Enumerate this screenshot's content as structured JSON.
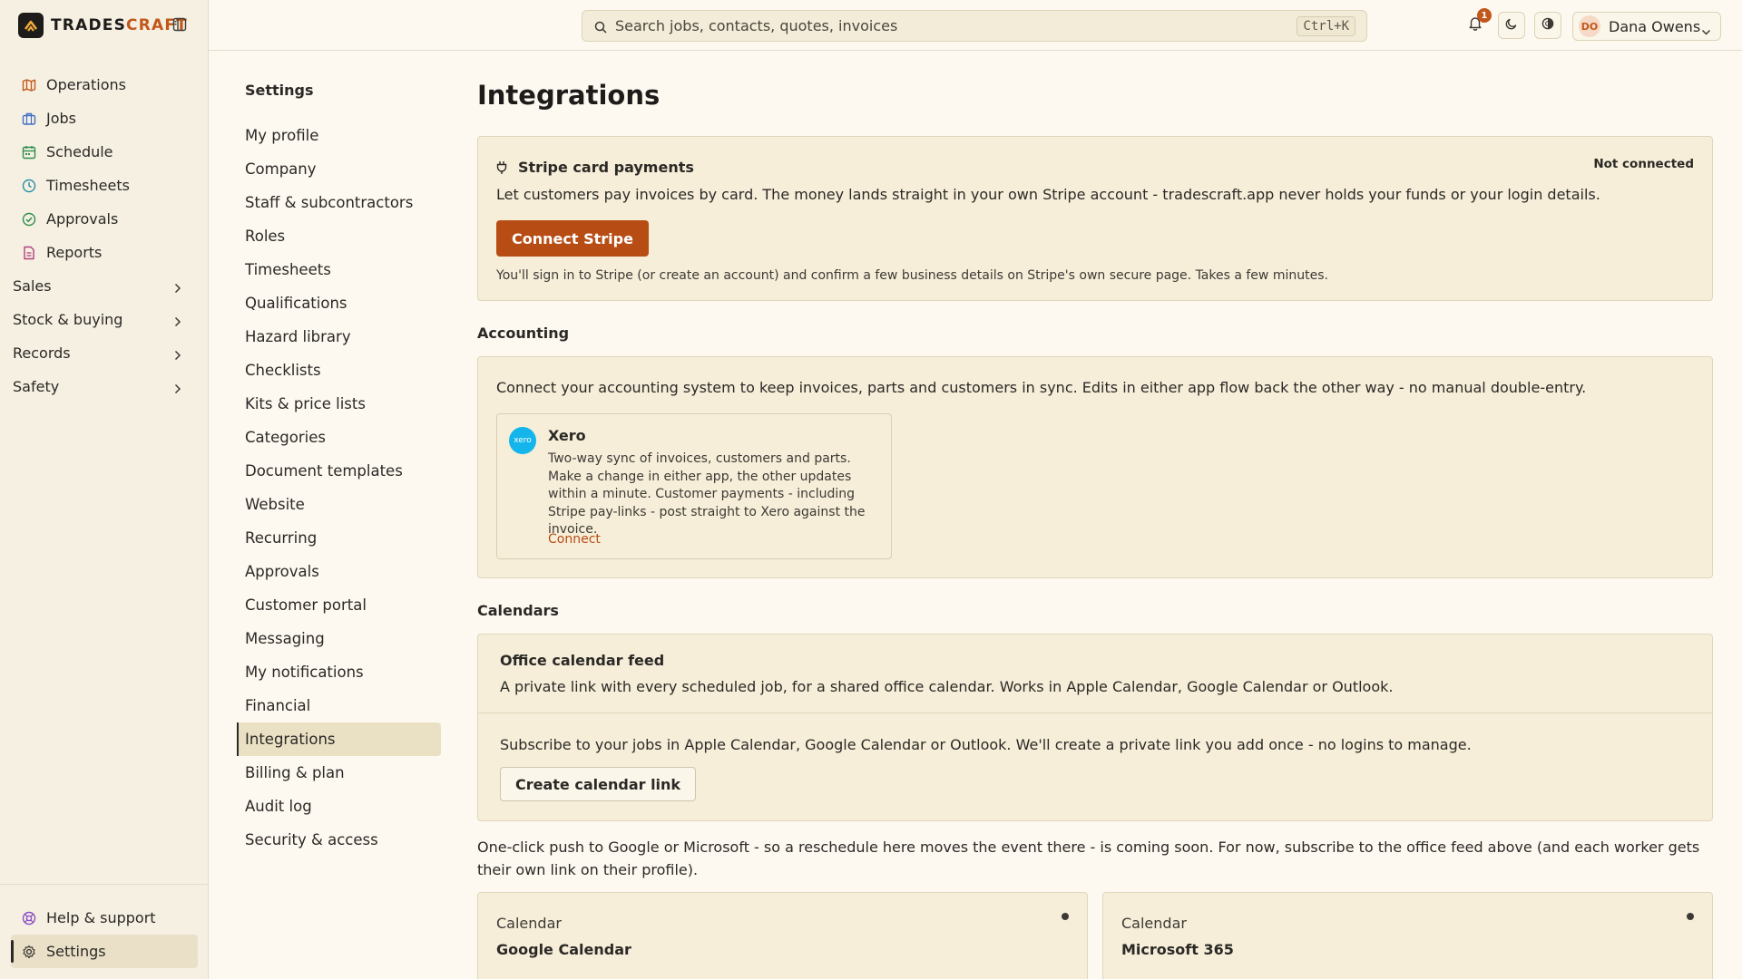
{
  "brand": {
    "name_part1": "TRADES",
    "name_part2": "CRAFT"
  },
  "sidebar": {
    "items": [
      {
        "label": "Operations",
        "icon": "map-icon",
        "color": "#c2571b"
      },
      {
        "label": "Jobs",
        "icon": "briefcase-icon",
        "color": "#3f6ec4"
      },
      {
        "label": "Schedule",
        "icon": "calendar-icon",
        "color": "#2f8f4e"
      },
      {
        "label": "Timesheets",
        "icon": "clock-icon",
        "color": "#2b8fa3"
      },
      {
        "label": "Approvals",
        "icon": "check-circle-icon",
        "color": "#2f8f4e"
      },
      {
        "label": "Reports",
        "icon": "report-icon",
        "color": "#b1407f"
      }
    ],
    "groups": [
      {
        "label": "Sales"
      },
      {
        "label": "Stock & buying"
      },
      {
        "label": "Records"
      },
      {
        "label": "Safety"
      }
    ],
    "bottom": [
      {
        "label": "Help & support",
        "icon": "help-icon",
        "color": "#8a4fc2"
      },
      {
        "label": "Settings",
        "icon": "gear-icon",
        "color": "#3d3a35"
      }
    ]
  },
  "topbar": {
    "search_placeholder": "Search jobs, contacts, quotes, invoices",
    "shortcut": "Ctrl+K",
    "notification_count": "1",
    "user_initials": "DO",
    "user_name": "Dana Owens"
  },
  "settings_nav": {
    "title": "Settings",
    "items": [
      "My profile",
      "Company",
      "Staff & subcontractors",
      "Roles",
      "Timesheets",
      "Qualifications",
      "Hazard library",
      "Checklists",
      "Kits & price lists",
      "Categories",
      "Document templates",
      "Website",
      "Recurring",
      "Approvals",
      "Customer portal",
      "Messaging",
      "My notifications",
      "Financial",
      "Integrations",
      "Billing & plan",
      "Audit log",
      "Security & access"
    ],
    "active_index": 18
  },
  "main": {
    "title": "Integrations",
    "stripe": {
      "title": "Stripe card payments",
      "status": "Not connected",
      "description": "Let customers pay invoices by card. The money lands straight in your own Stripe account - tradescraft.app never holds your funds or your login details.",
      "button": "Connect Stripe",
      "note": "You'll sign in to Stripe (or create an account) and confirm a few business details on Stripe's own secure page. Takes a few minutes."
    },
    "accounting": {
      "heading": "Accounting",
      "description": "Connect your accounting system to keep invoices, parts and customers in sync. Edits in either app flow back the other way - no manual double-entry.",
      "xero": {
        "logo_text": "xero",
        "name": "Xero",
        "description": "Two-way sync of invoices, customers and parts. Make a change in either app, the other updates within a minute. Customer payments - including Stripe pay-links - post straight to Xero against the invoice.",
        "link": "Connect"
      }
    },
    "calendars": {
      "heading": "Calendars",
      "feed_title": "Office calendar feed",
      "feed_subtitle": "A private link with every scheduled job, for a shared office calendar. Works in Apple Calendar, Google Calendar or Outlook.",
      "feed_description": "Subscribe to your jobs in Apple Calendar, Google Calendar or Outlook. We'll create a private link you add once - no logins to manage.",
      "feed_button": "Create calendar link",
      "note": "One-click push to Google or Microsoft - so a reschedule here moves the event there - is coming soon. For now, subscribe to the office feed above (and each worker gets their own link on their profile).",
      "providers": [
        {
          "label": "Calendar",
          "name": "Google Calendar"
        },
        {
          "label": "Calendar",
          "name": "Microsoft 365"
        }
      ]
    }
  }
}
